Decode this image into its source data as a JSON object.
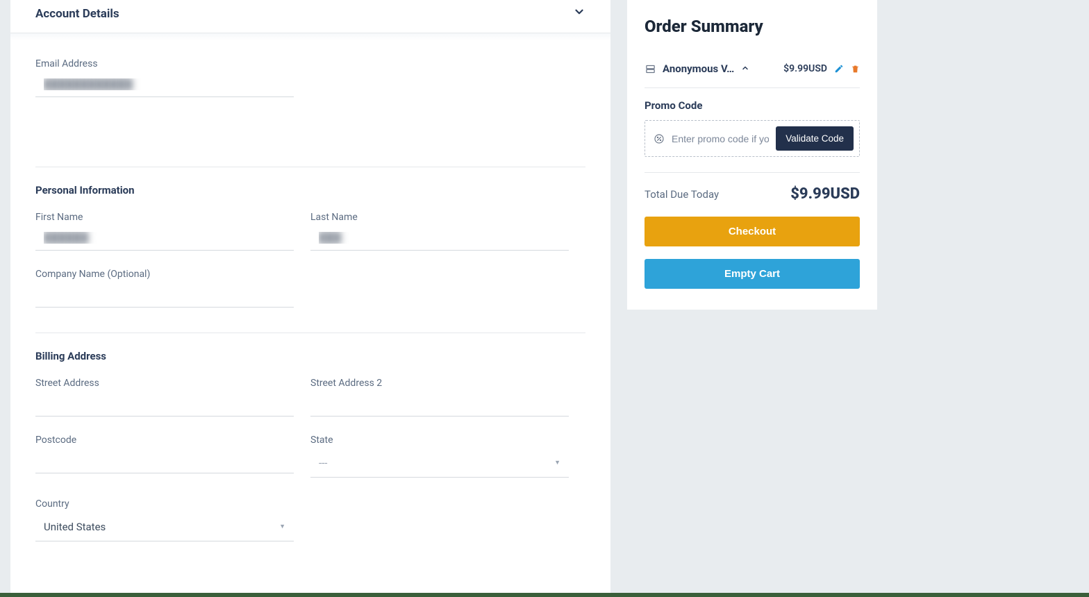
{
  "account": {
    "header_title": "Account Details",
    "email_label": "Email Address",
    "email_value": "████████████"
  },
  "personal": {
    "title": "Personal Information",
    "first_name_label": "First Name",
    "first_name_value": "██████",
    "last_name_label": "Last Name",
    "last_name_value": "███",
    "company_label": "Company Name (Optional)",
    "company_value": ""
  },
  "billing": {
    "title": "Billing Address",
    "street_label": "Street Address",
    "street_value": "",
    "street2_label": "Street Address 2",
    "street2_value": "",
    "postcode_label": "Postcode",
    "postcode_value": "",
    "state_label": "State",
    "state_value": "---",
    "country_label": "Country",
    "country_value": "United States"
  },
  "summary": {
    "title": "Order Summary",
    "item_name": "Anonymous V…",
    "item_price": "$9.99USD",
    "promo_title": "Promo Code",
    "promo_placeholder": "Enter promo code if you",
    "validate_label": "Validate Code",
    "total_label": "Total Due Today",
    "total_amount": "$9.99USD",
    "checkout_label": "Checkout",
    "empty_cart_label": "Empty Cart"
  }
}
